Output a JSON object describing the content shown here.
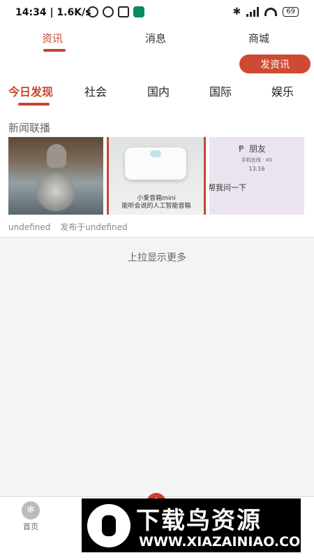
{
  "status": {
    "time": "14:34 | 1.6K/s",
    "battery": "69"
  },
  "top_tabs": {
    "news": "资讯",
    "messages": "消息",
    "mall": "商城"
  },
  "post_button": "发资讯",
  "categories": [
    "今日发现",
    "社会",
    "国内",
    "国际",
    "娱乐"
  ],
  "section_title": "新闻联播",
  "images": {
    "speaker_caption1": "小爱音箱mini",
    "speaker_caption2": "能听会说的人工智能音箱",
    "phone_name": "朋友",
    "phone_sub": "手机在线 · 4G",
    "phone_time": "13:16",
    "phone_msg": "帮我问一下"
  },
  "meta": {
    "author": "undefined",
    "published": "发布于undefined"
  },
  "load_more": "上拉显示更多",
  "bottom_nav": {
    "home_label": "首页"
  },
  "watermark": {
    "title": "下载鸟资源",
    "url": "WWW.XIAZAINIAO.COM"
  },
  "colors": {
    "accent": "#c4472f",
    "button": "#cf4a32"
  }
}
